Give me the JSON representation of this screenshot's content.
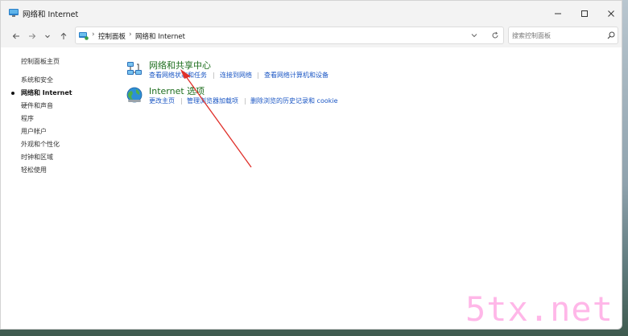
{
  "window": {
    "title": "网络和 Internet"
  },
  "controls": {
    "minimize": "minimize",
    "maximize": "maximize",
    "close": "close"
  },
  "nav": {
    "breadcrumb": [
      "控制面板",
      "网络和 Internet"
    ]
  },
  "search": {
    "placeholder": "搜索控制面板"
  },
  "sidebar": {
    "home": "控制面板主页",
    "items": [
      {
        "label": "系统和安全",
        "active": false
      },
      {
        "label": "网络和 Internet",
        "active": true
      },
      {
        "label": "硬件和声音",
        "active": false
      },
      {
        "label": "程序",
        "active": false
      },
      {
        "label": "用户帐户",
        "active": false
      },
      {
        "label": "外观和个性化",
        "active": false
      },
      {
        "label": "时钟和区域",
        "active": false
      },
      {
        "label": "轻松使用",
        "active": false
      }
    ]
  },
  "categories": [
    {
      "title": "网络和共享中心",
      "links": [
        "查看网络状态和任务",
        "连接到网络",
        "查看网络计算机和设备"
      ]
    },
    {
      "title": "Internet 选项",
      "links": [
        "更改主页",
        "管理浏览器加载项",
        "删除浏览的历史记录和 cookie"
      ]
    }
  ],
  "colors": {
    "category_title": "#1e6e1e",
    "link": "#1a56c4",
    "annotation_arrow": "#e0302a",
    "watermark": "#ffb7e8"
  },
  "watermark": "5tx.net"
}
